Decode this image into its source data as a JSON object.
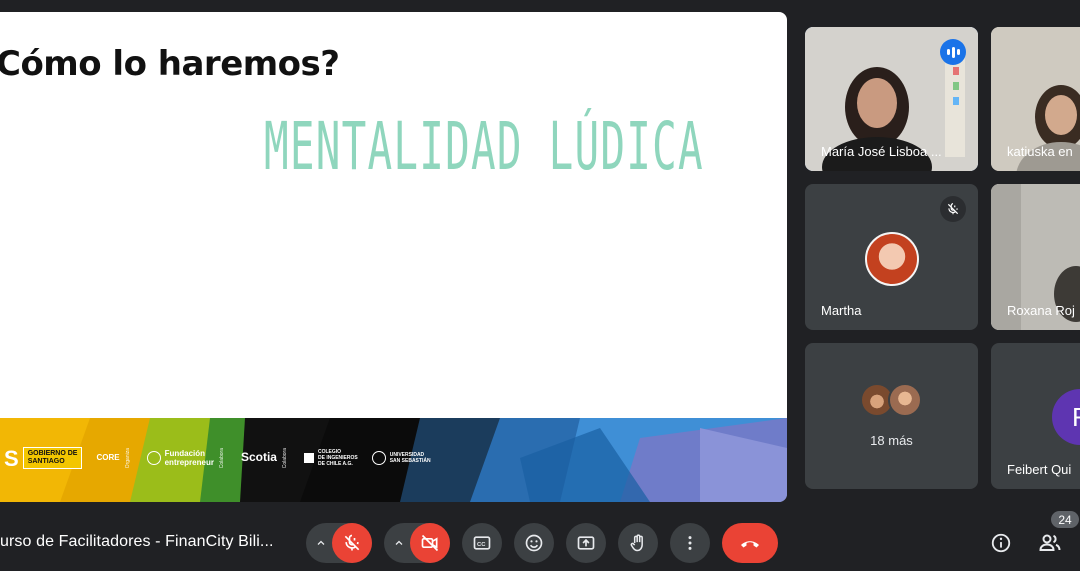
{
  "slide": {
    "title": "Cómo lo haremos?",
    "subtitle": "MENTALIDAD LÚDICA",
    "logos": {
      "gobierno": "GOBIERNO DE\nSANTIAGO",
      "core": "CORE",
      "core_side": "Organiza",
      "fundacion": "Fundación\nentrepreneur",
      "fundacion_side": "Colabora",
      "scotia": "Scotia",
      "scotia_side": "Colabora",
      "colegio": "COLEGIO\nDE INGENIEROS\nDE CHILE A.G.",
      "universidad": "UNIVERSIDAD\nSAN SEBASTIÁN"
    }
  },
  "participants": [
    {
      "name": "María José Lisboa ...",
      "state": "speaking"
    },
    {
      "name": "katiuska en"
    },
    {
      "name": "Martha",
      "state": "muted"
    },
    {
      "name": "Roxana Roj"
    },
    {
      "label": "18 más"
    },
    {
      "name": "Feibert Qui",
      "initial": "F"
    }
  ],
  "toolbar": {
    "meeting_title": "urso de Facilitadores - FinanCity Bili...",
    "participant_count": "24",
    "buttons": [
      "mic-off",
      "camera-off",
      "captions",
      "emoji",
      "present",
      "raise-hand",
      "more",
      "end-call"
    ]
  },
  "colors": {
    "background": "#202124",
    "tile": "#3c4043",
    "danger": "#ea4335",
    "accent": "#1a73e8",
    "subtitle": "#8fd6bd"
  }
}
